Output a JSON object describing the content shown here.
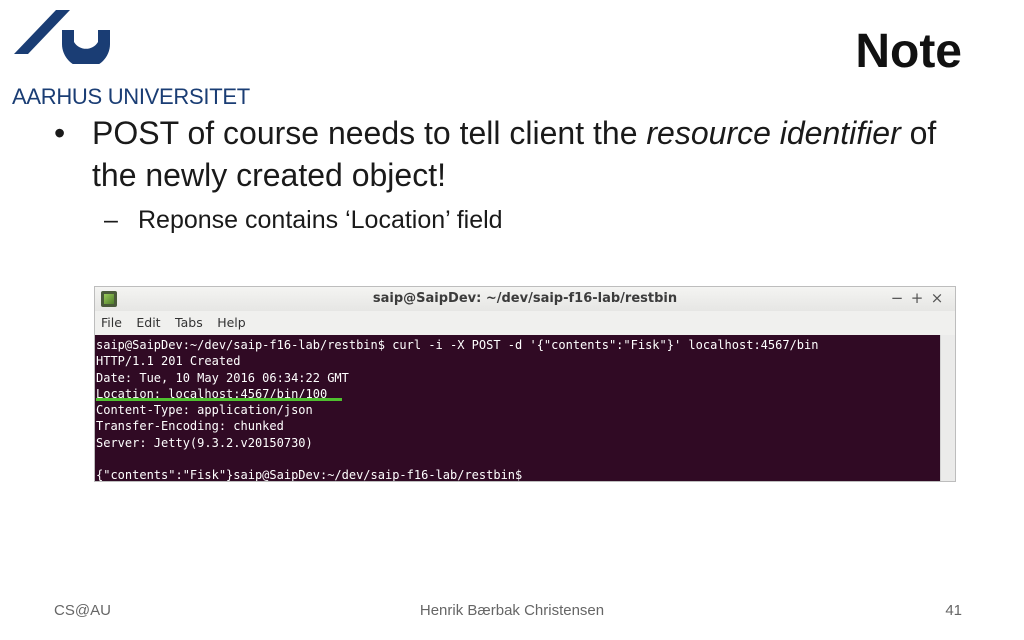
{
  "logo": {
    "text": "AARHUS UNIVERSITET",
    "color": "#1a3d74"
  },
  "slide": {
    "title": "Note",
    "bullet_marker": "•",
    "bullet1_part1": "POST of course needs to tell client the ",
    "bullet1_emph": "resource identifier",
    "bullet1_part2": " of the newly created object!",
    "sub_dash": "–",
    "sub_bullet": "Reponse contains ‘Location’ field"
  },
  "terminal": {
    "window_title": "saip@SaipDev: ~/dev/saip-f16-lab/restbin",
    "controls": {
      "minimize": "−",
      "maximize": "+",
      "close": "×"
    },
    "menu": [
      "File",
      "Edit",
      "Tabs",
      "Help"
    ],
    "lines": [
      "saip@SaipDev:~/dev/saip-f16-lab/restbin$ curl -i -X POST -d '{\"contents\":\"Fisk\"}' localhost:4567/bin",
      "HTTP/1.1 201 Created",
      "Date: Tue, 10 May 2016 06:34:22 GMT",
      "Location: localhost:4567/bin/100",
      "Content-Type: application/json",
      "Transfer-Encoding: chunked",
      "Server: Jetty(9.3.2.v20150730)",
      "",
      "{\"contents\":\"Fisk\"}saip@SaipDev:~/dev/saip-f16-lab/restbin$"
    ],
    "background_color": "#300a24",
    "highlight_color": "#4fbf2f"
  },
  "footer": {
    "left": "CS@AU",
    "center": "Henrik Bærbak Christensen",
    "page_number": "41"
  }
}
